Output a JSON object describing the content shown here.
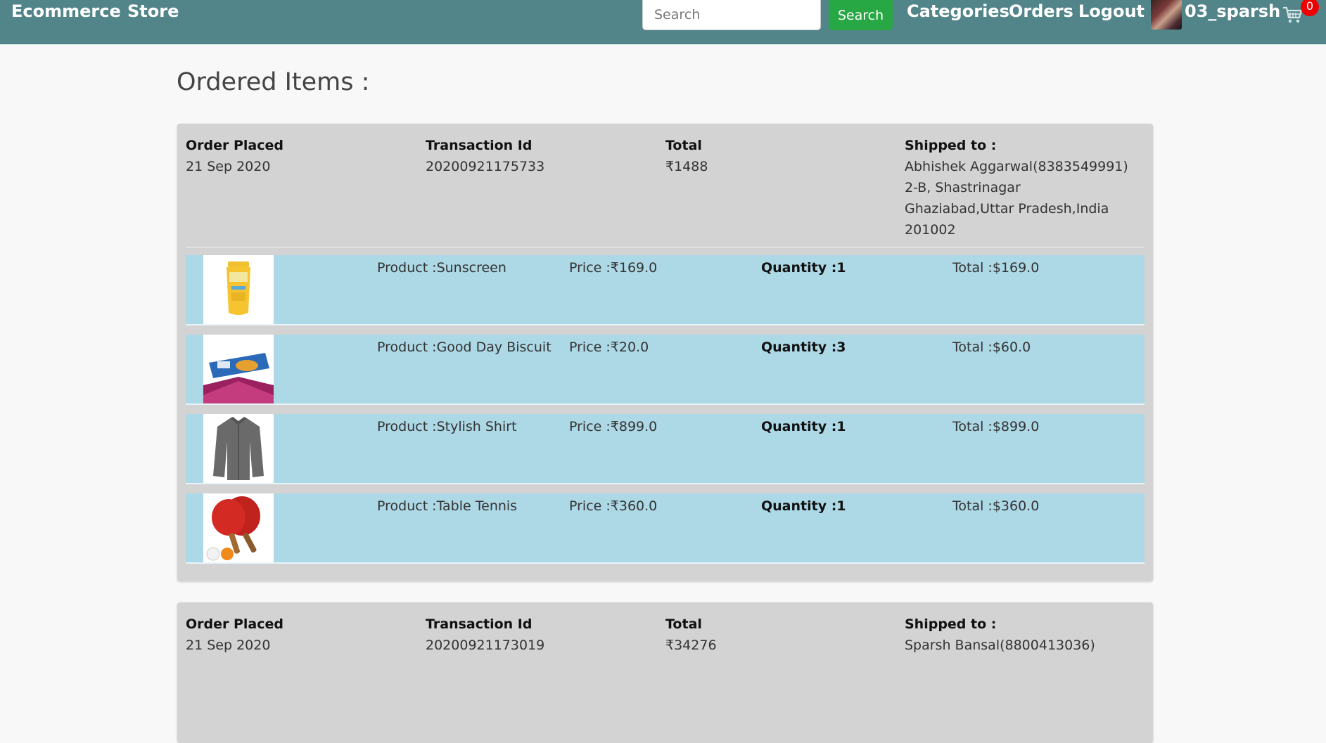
{
  "nav": {
    "brand": "Ecommerce",
    "store": "Store",
    "search_placeholder": "Search",
    "search_button": "Search",
    "categories": "Categories",
    "orders": "Orders",
    "logout": "Logout",
    "username": "03_sparsh",
    "cart_count": "0",
    "colors": {
      "navbar": "#528589",
      "search_button": "#28a745",
      "badge": "#ee0000"
    }
  },
  "page": {
    "title": "Ordered Items :"
  },
  "orders": [
    {
      "placed_label": "Order Placed",
      "placed_date": "21 Sep 2020",
      "txn_label": "Transaction Id",
      "txn_id": "20200921175733",
      "total_label": "Total",
      "total": "₹1488",
      "ship_label": "Shipped to :",
      "ship_lines": [
        "Abhishek Aggarwal(8383549991)",
        "2-B, Shastrinagar",
        "Ghaziabad,Uttar Pradesh,India",
        "201002"
      ],
      "items": [
        {
          "image": "sunscreen-image",
          "product": "Product :Sunscreen",
          "price": "Price :₹169.0",
          "quantity": "Quantity :1",
          "total": "Total :$169.0"
        },
        {
          "image": "biscuit-image",
          "product": "Product :Good Day Biscuit",
          "price": "Price :₹20.0",
          "quantity": "Quantity :3",
          "total": "Total :$60.0"
        },
        {
          "image": "shirt-image",
          "product": "Product :Stylish Shirt",
          "price": "Price :₹899.0",
          "quantity": "Quantity :1",
          "total": "Total :$899.0"
        },
        {
          "image": "table-tennis-image",
          "product": "Product :Table Tennis",
          "price": "Price :₹360.0",
          "quantity": "Quantity :1",
          "total": "Total :$360.0"
        }
      ]
    },
    {
      "placed_label": "Order Placed",
      "placed_date": "21 Sep 2020",
      "txn_label": "Transaction Id",
      "txn_id": "20200921173019",
      "total_label": "Total",
      "total": "₹34276",
      "ship_label": "Shipped to :",
      "ship_lines": [
        "Sparsh Bansal(8800413036)"
      ]
    }
  ]
}
